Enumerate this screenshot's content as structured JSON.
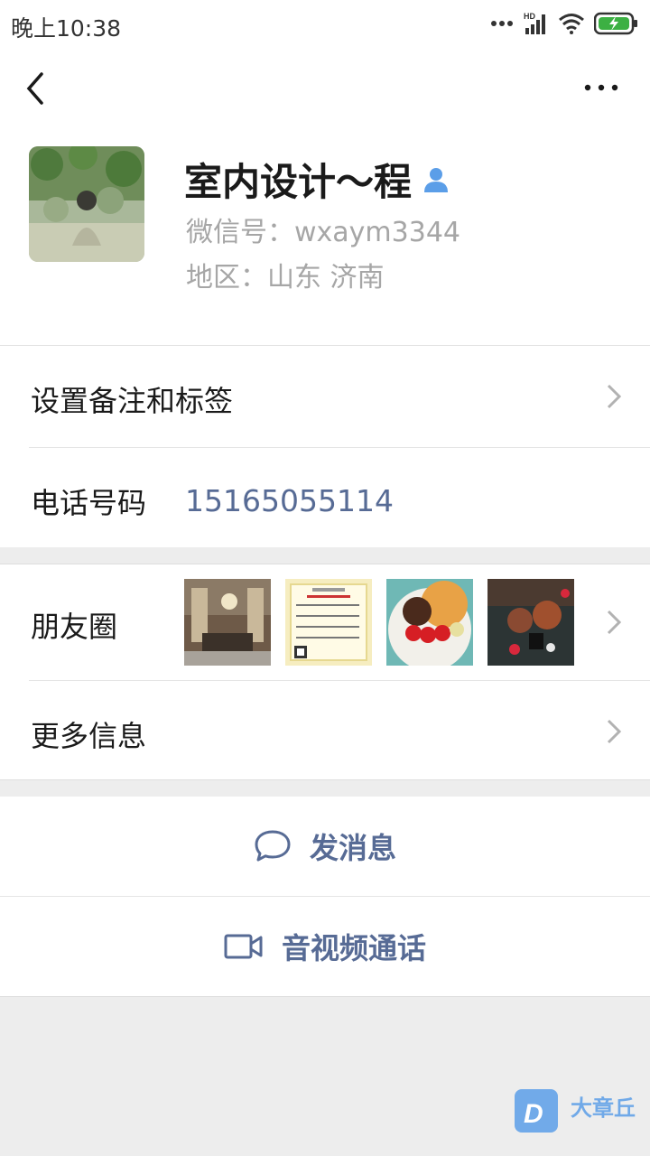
{
  "status": {
    "time": "晚上10:38",
    "network": "HD"
  },
  "profile": {
    "name": "室内设计～程",
    "wechat_id": "微信号：wxaym3344",
    "region": "地区：山东  济南"
  },
  "rows": {
    "remark": "设置备注和标签",
    "phone_label": "电话号码",
    "phone_value": "15165055114",
    "moments": "朋友圈",
    "more_info": "更多信息"
  },
  "actions": {
    "message": "发消息",
    "call": "音视频通话"
  },
  "watermark": {
    "brand": "大章丘"
  },
  "colors": {
    "link": "#576b95",
    "secondary": "#a6a6a6",
    "badge": "#5b9ee8"
  }
}
